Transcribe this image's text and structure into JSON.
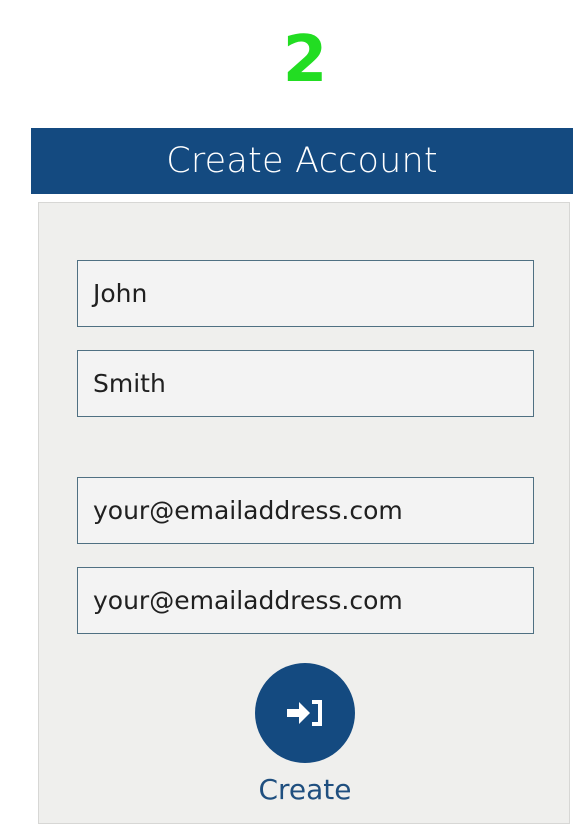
{
  "step": {
    "number": "2"
  },
  "header": {
    "title": "Create Account"
  },
  "form": {
    "first_name": {
      "value": "John"
    },
    "last_name": {
      "value": "Smith"
    },
    "email": {
      "value": "your@emailaddress.com"
    },
    "email_confirm": {
      "value": "your@emailaddress.com"
    },
    "submit": {
      "label": "Create",
      "icon": "sign-in-icon"
    }
  },
  "colors": {
    "accent": "#144a80",
    "step_number": "#22dd22",
    "panel_background": "#efefed",
    "field_border": "#4f7082"
  }
}
